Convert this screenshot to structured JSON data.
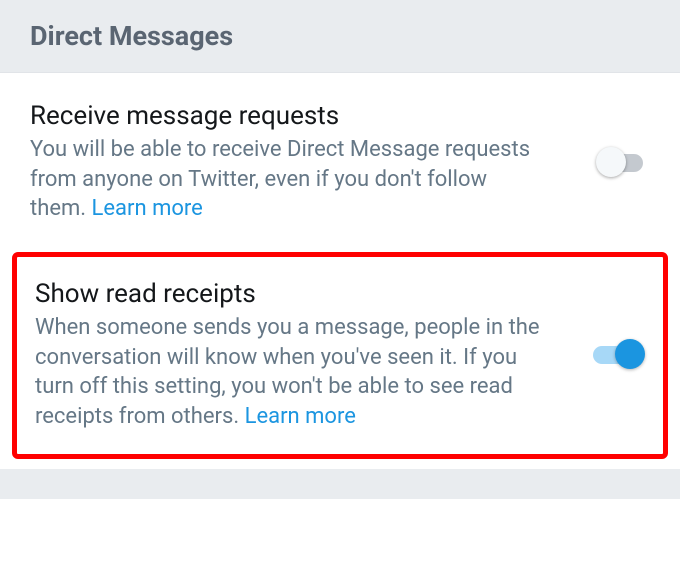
{
  "header": {
    "title": "Direct Messages"
  },
  "settings": {
    "receive_requests": {
      "title": "Receive message requests",
      "description": "You will be able to receive Direct Message requests from anyone on Twitter, even if you don't follow them. ",
      "learn_more": "Learn more",
      "enabled": false
    },
    "read_receipts": {
      "title": "Show read receipts",
      "description": "When someone sends you a message, people in the conversation will know when you've seen it. If you turn off this setting, you won't be able to see read receipts from others. ",
      "learn_more": "Learn more",
      "enabled": true
    }
  }
}
